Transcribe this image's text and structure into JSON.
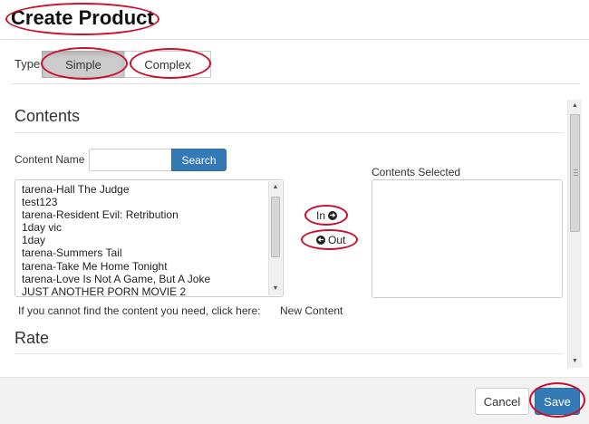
{
  "header": {
    "title": "Create Product"
  },
  "type_selector": {
    "label": "Type",
    "options": [
      {
        "label": "Simple",
        "active": true
      },
      {
        "label": "Complex",
        "active": false
      }
    ]
  },
  "contents": {
    "heading": "Contents",
    "search": {
      "label": "Content Name",
      "value": "",
      "placeholder": "",
      "button_label": "Search"
    },
    "list_items": [
      "tarena-Hall The Judge",
      "test123",
      "tarena-Resident Evil: Retribution",
      "1day vic",
      "1day",
      "tarena-Summers Tail",
      "tarena-Take Me Home Tonight",
      "tarena-Love Is Not A Game, But A Joke",
      "JUST ANOTHER PORN MOVIE 2"
    ],
    "in_button": {
      "label": "In",
      "icon": "circle-arrow-right-icon"
    },
    "out_button": {
      "label": "Out",
      "icon": "circle-arrow-left-icon"
    },
    "selected_label": "Contents Selected",
    "hint": "If you cannot find the content you need, click here:",
    "new_content_link": "New Content"
  },
  "rate": {
    "heading": "Rate"
  },
  "footer": {
    "cancel_label": "Cancel",
    "save_label": "Save"
  },
  "colors": {
    "primary": "#337ab7",
    "annotation": "#c8102e",
    "active_toggle": "#cccccc",
    "footer_bg": "#f2f2f2"
  }
}
